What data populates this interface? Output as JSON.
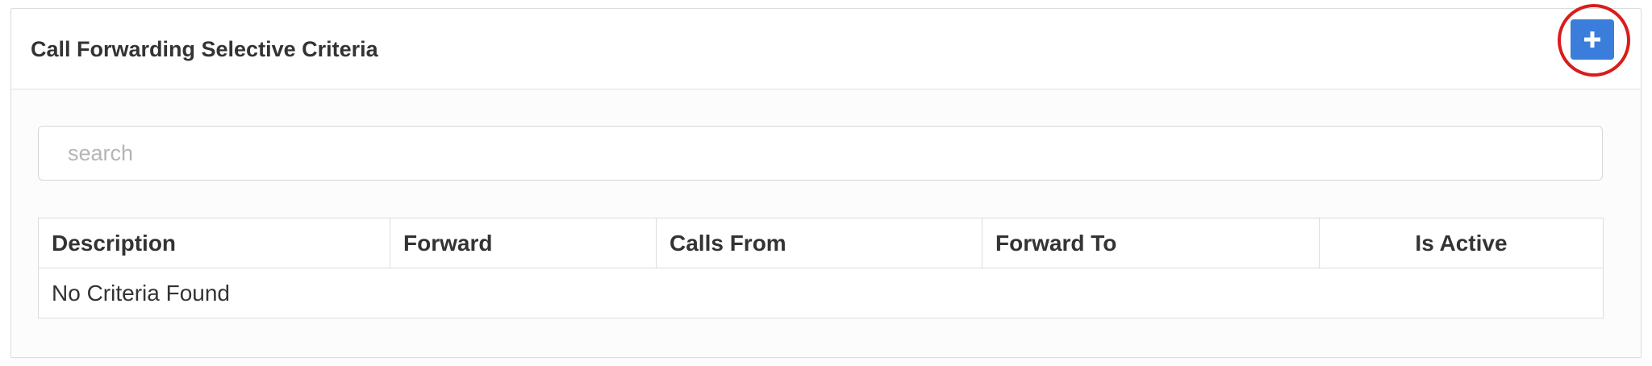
{
  "panel": {
    "title": "Call Forwarding Selective Criteria",
    "add_button_icon": "plus-icon",
    "accent_color": "#3a7ddb",
    "highlight_color": "#d91c1c"
  },
  "search": {
    "placeholder": "search",
    "value": ""
  },
  "table": {
    "columns": [
      "Description",
      "Forward",
      "Calls From",
      "Forward To",
      "Is Active"
    ],
    "empty_message": "No Criteria Found"
  }
}
